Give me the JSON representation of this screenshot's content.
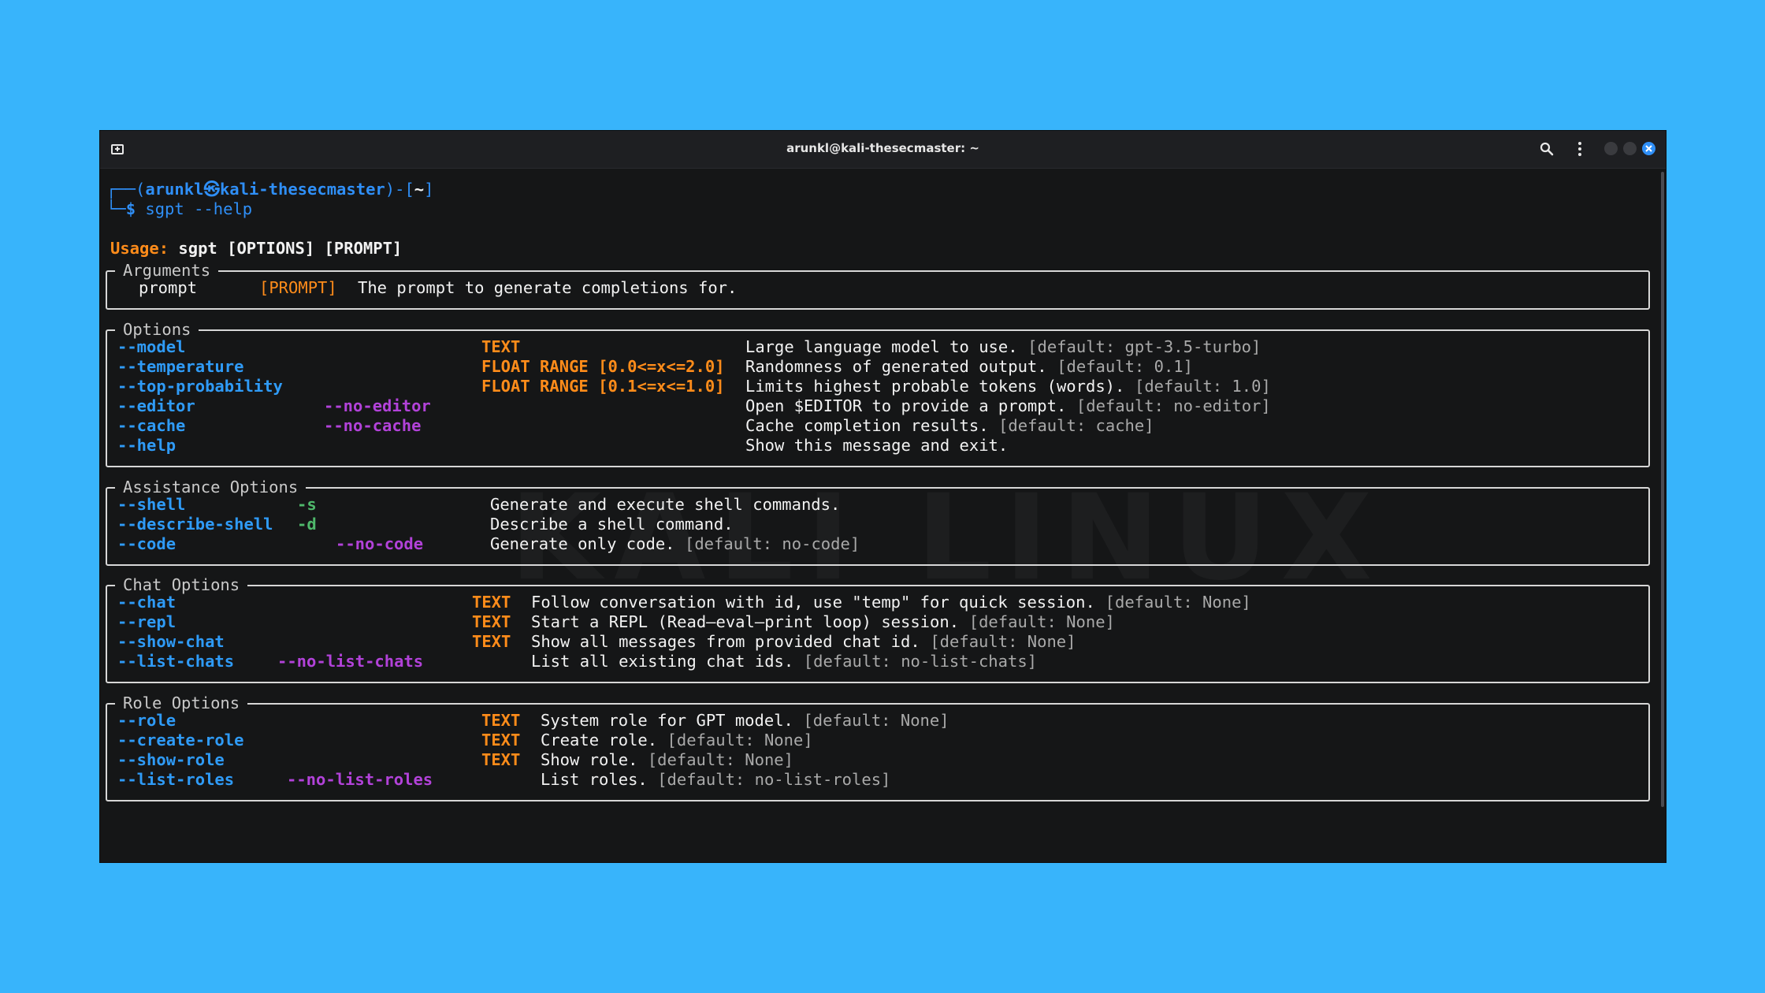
{
  "window": {
    "title": "arunkl@kali-thesecmaster: ~",
    "watermark": "KALI LINUX"
  },
  "prompt": {
    "corner_top": "┌──(",
    "user": "arunkl",
    "at": "㉿",
    "host": "kali-thesecmaster",
    "mid": ")-[",
    "path": "~",
    "end": "]",
    "corner_bottom": "└─",
    "dollar": "$",
    "command": "sgpt --help"
  },
  "usage": {
    "label": "Usage:",
    "text": "sgpt [OPTIONS] [PROMPT]"
  },
  "arguments": {
    "title": "Arguments",
    "rows": [
      {
        "name": "prompt",
        "type": "[PROMPT]",
        "desc": "The prompt to generate completions for."
      }
    ]
  },
  "options": {
    "title": "Options",
    "rows": [
      {
        "flag": "--model",
        "neg": "",
        "type": "TEXT",
        "desc": "Large language model to use.",
        "default": "[default: gpt-3.5-turbo]"
      },
      {
        "flag": "--temperature",
        "neg": "",
        "type": "FLOAT RANGE [0.0<=x<=2.0]",
        "desc": "Randomness of generated output.",
        "default": "[default: 0.1]"
      },
      {
        "flag": "--top-probability",
        "neg": "",
        "type": "FLOAT RANGE [0.1<=x<=1.0]",
        "desc": "Limits highest probable tokens (words).",
        "default": "[default: 1.0]"
      },
      {
        "flag": "--editor",
        "neg": "--no-editor",
        "type": "",
        "desc": "Open $EDITOR to provide a prompt.",
        "default": "[default: no-editor]"
      },
      {
        "flag": "--cache",
        "neg": "--no-cache",
        "type": "",
        "desc": "Cache completion results.",
        "default": "[default: cache]"
      },
      {
        "flag": "--help",
        "neg": "",
        "type": "",
        "desc": "Show this message and exit.",
        "default": ""
      }
    ]
  },
  "assistance": {
    "title": "Assistance Options",
    "rows": [
      {
        "flag": "--shell",
        "short": "-s",
        "neg": "",
        "desc": "Generate and execute shell commands.",
        "default": ""
      },
      {
        "flag": "--describe-shell",
        "short": "-d",
        "neg": "",
        "desc": "Describe a shell command.",
        "default": ""
      },
      {
        "flag": "--code",
        "short": "",
        "neg": "--no-code",
        "desc": "Generate only code.",
        "default": "[default: no-code]"
      }
    ]
  },
  "chat": {
    "title": "Chat Options",
    "rows": [
      {
        "flag": "--chat",
        "neg": "",
        "type": "TEXT",
        "desc": "Follow conversation with id, use \"temp\" for quick session.",
        "default": "[default: None]"
      },
      {
        "flag": "--repl",
        "neg": "",
        "type": "TEXT",
        "desc": "Start a REPL (Read–eval–print loop) session.",
        "default": "[default: None]"
      },
      {
        "flag": "--show-chat",
        "neg": "",
        "type": "TEXT",
        "desc": "Show all messages from provided chat id.",
        "default": "[default: None]"
      },
      {
        "flag": "--list-chats",
        "neg": "--no-list-chats",
        "type": "",
        "desc": "List all existing chat ids.",
        "default": "[default: no-list-chats]"
      }
    ]
  },
  "role": {
    "title": "Role Options",
    "rows": [
      {
        "flag": "--role",
        "neg": "",
        "type": "TEXT",
        "desc": "System role for GPT model.",
        "default": "[default: None]"
      },
      {
        "flag": "--create-role",
        "neg": "",
        "type": "TEXT",
        "desc": "Create role.",
        "default": "[default: None]"
      },
      {
        "flag": "--show-role",
        "neg": "",
        "type": "TEXT",
        "desc": "Show role.",
        "default": "[default: None]"
      },
      {
        "flag": "--list-roles",
        "neg": "--no-list-roles",
        "type": "",
        "desc": "List roles.",
        "default": "[default: no-list-roles]"
      }
    ]
  },
  "colors": {
    "background": "#38b4fb",
    "terminal_bg": "#151617",
    "flag_blue": "#2f9bf7",
    "type_orange": "#ff8c1a",
    "neg_purple": "#b242d9",
    "short_green": "#4fb86b"
  },
  "icons": [
    "new-tab-icon",
    "search-icon",
    "kebab-menu-icon",
    "minimize-icon",
    "maximize-icon",
    "close-icon"
  ]
}
